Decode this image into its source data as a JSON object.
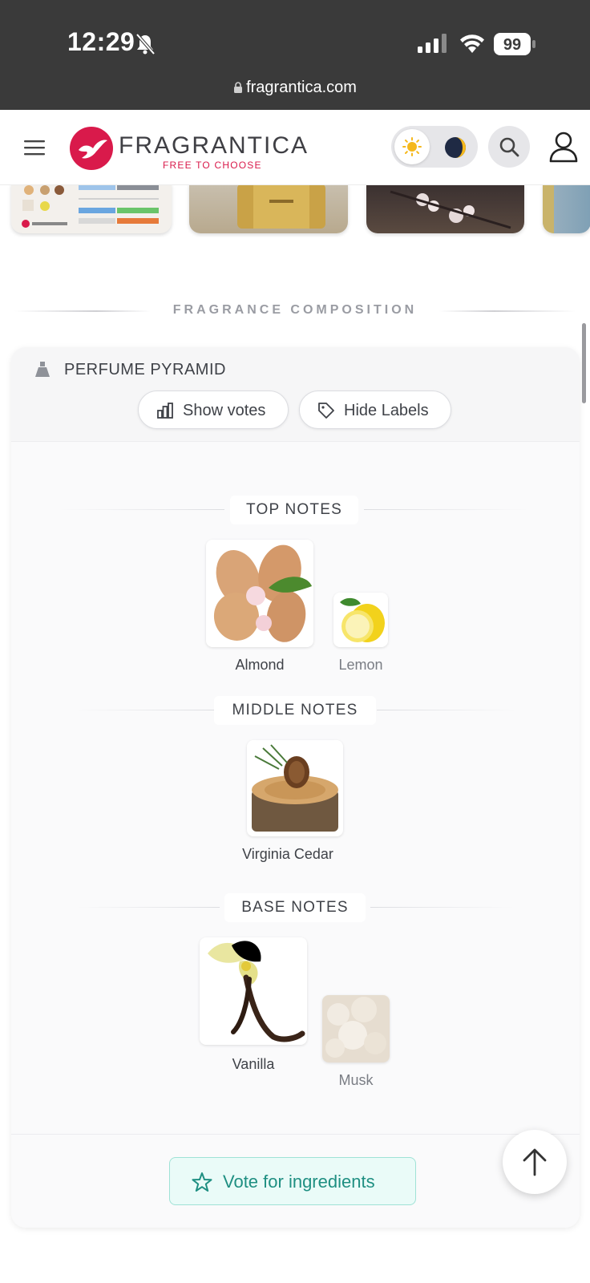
{
  "status_bar": {
    "time": "12:29",
    "battery": "99",
    "url": "fragrantica.com"
  },
  "header": {
    "brand": "FRAGRANTICA",
    "tagline": "FREE TO CHOOSE",
    "accent_color": "#d91a4b"
  },
  "section": {
    "title": "FRAGRANCE COMPOSITION"
  },
  "pyramid": {
    "title": "PERFUME PYRAMID",
    "show_votes_label": "Show votes",
    "hide_labels_label": "Hide Labels",
    "top": {
      "label": "TOP NOTES",
      "notes": [
        "Almond",
        "Lemon"
      ]
    },
    "middle": {
      "label": "MIDDLE NOTES",
      "notes": [
        "Virginia Cedar"
      ]
    },
    "base": {
      "label": "BASE NOTES",
      "notes": [
        "Vanilla",
        "Musk"
      ]
    },
    "vote_button_label": "Vote for ingredients",
    "vote_color": "#1f8f82"
  }
}
